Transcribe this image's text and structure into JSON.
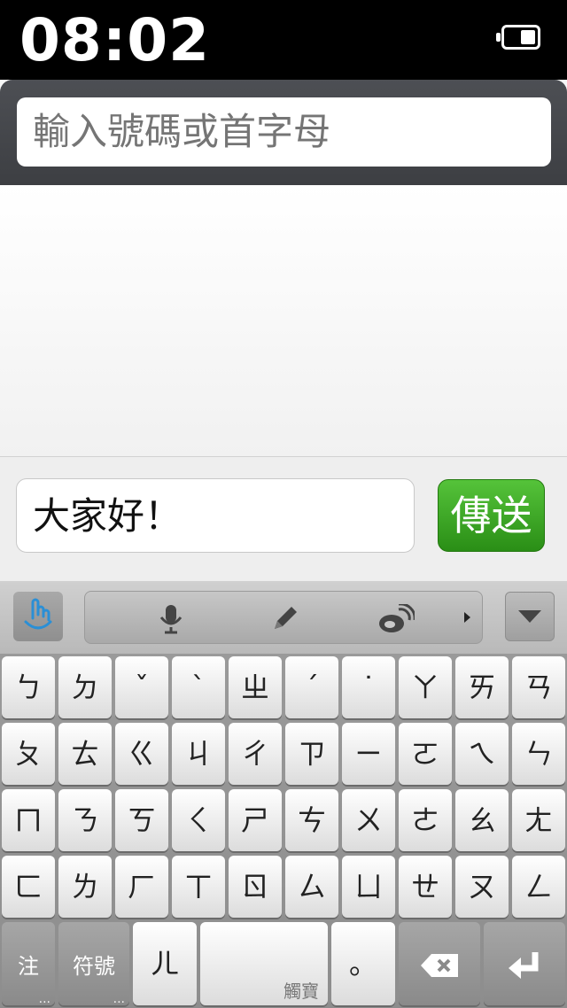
{
  "status_bar": {
    "time": "08:02",
    "battery_icon": "battery-icon"
  },
  "search": {
    "placeholder": "輸入號碼或首字母"
  },
  "compose": {
    "message": "大家好！",
    "send_label": "傳送"
  },
  "toolbar": {
    "icons": [
      "hand-touch-icon",
      "microphone-icon",
      "pencil-icon",
      "weibo-icon",
      "arrow-right-icon",
      "collapse-keyboard-icon"
    ]
  },
  "keyboard": {
    "rows": [
      [
        "ㄅ",
        "ㄉ",
        "ˇ",
        "ˋ",
        "ㄓ",
        "ˊ",
        "˙",
        "ㄚ",
        "ㄞ",
        "ㄢ"
      ],
      [
        "ㄆ",
        "ㄊ",
        "ㄍ",
        "ㄐ",
        "ㄔ",
        "ㄗ",
        "ㄧ",
        "ㄛ",
        "ㄟ",
        "ㄣ"
      ],
      [
        "ㄇ",
        "ㄋ",
        "ㄎ",
        "ㄑ",
        "ㄕ",
        "ㄘ",
        "ㄨ",
        "ㄜ",
        "ㄠ",
        "ㄤ"
      ],
      [
        "ㄈ",
        "ㄌ",
        "ㄏ",
        "ㄒ",
        "ㄖ",
        "ㄙ",
        "ㄩ",
        "ㄝ",
        "ㄡ",
        "ㄥ"
      ]
    ],
    "bottom": {
      "zhu": "注",
      "symbols": "符號",
      "er": "ㄦ",
      "space_hint": "觸寶",
      "period": "。",
      "more": "..."
    }
  }
}
